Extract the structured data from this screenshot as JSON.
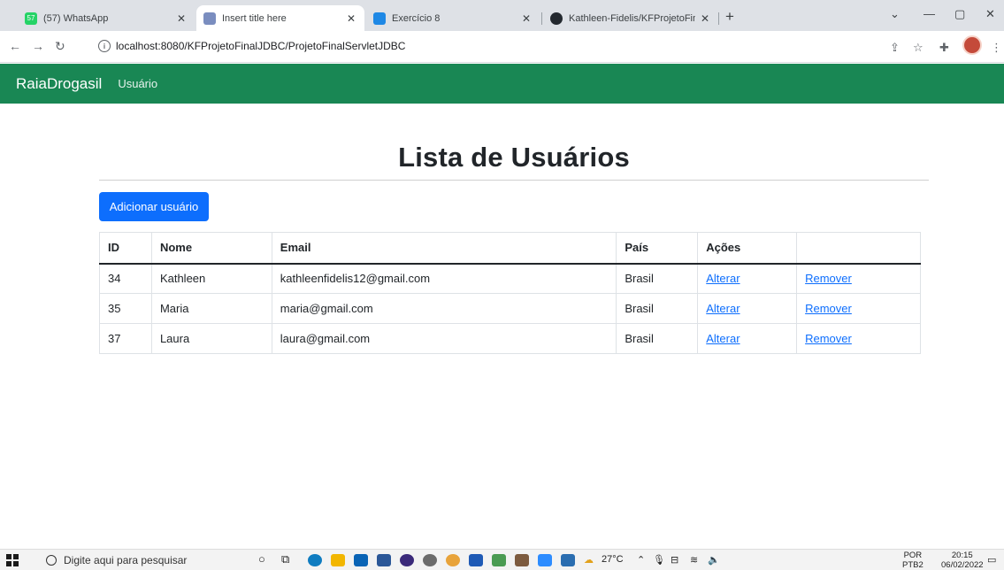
{
  "browser": {
    "tabs": [
      {
        "title": "(57) WhatsApp",
        "icon": "whatsapp-icon",
        "color": "#25d366",
        "badge": "57"
      },
      {
        "title": "Insert title here",
        "icon": "page-icon",
        "color": "#7a8dbf",
        "active": true
      },
      {
        "title": "Exercício 8",
        "icon": "classroom-icon",
        "color": "#1e88e5"
      },
      {
        "title": "Kathleen-Fidelis/KFProjetoFinalJDBC",
        "icon": "github-icon",
        "color": "#24292f"
      }
    ],
    "new_tab": "+",
    "url": "localhost:8080/KFProjetoFinalJDBC/ProjetoFinalServletJDBC"
  },
  "navbar": {
    "brand": "RaiaDrogasil",
    "link": "Usuário",
    "color": "#198754"
  },
  "main": {
    "title": "Lista de Usuários",
    "add_button": "Adicionar usuário"
  },
  "table": {
    "headers": [
      "ID",
      "Nome",
      "Email",
      "País",
      "Ações",
      ""
    ],
    "rows": [
      {
        "id": "34",
        "nome": "Kathleen",
        "email": "kathleenfidelis12@gmail.com",
        "pais": "Brasil",
        "edit": "Alterar",
        "remove": "Remover"
      },
      {
        "id": "35",
        "nome": "Maria",
        "email": "maria@gmail.com",
        "pais": "Brasil",
        "edit": "Alterar",
        "remove": "Remover"
      },
      {
        "id": "37",
        "nome": "Laura",
        "email": "laura@gmail.com",
        "pais": "Brasil",
        "edit": "Alterar",
        "remove": "Remover"
      }
    ]
  },
  "taskbar": {
    "search_placeholder": "Digite aqui para pesquisar",
    "weather": "27°C",
    "lang_top": "POR",
    "lang_bottom": "PTB2",
    "time": "20:15",
    "date": "06/02/2022"
  }
}
